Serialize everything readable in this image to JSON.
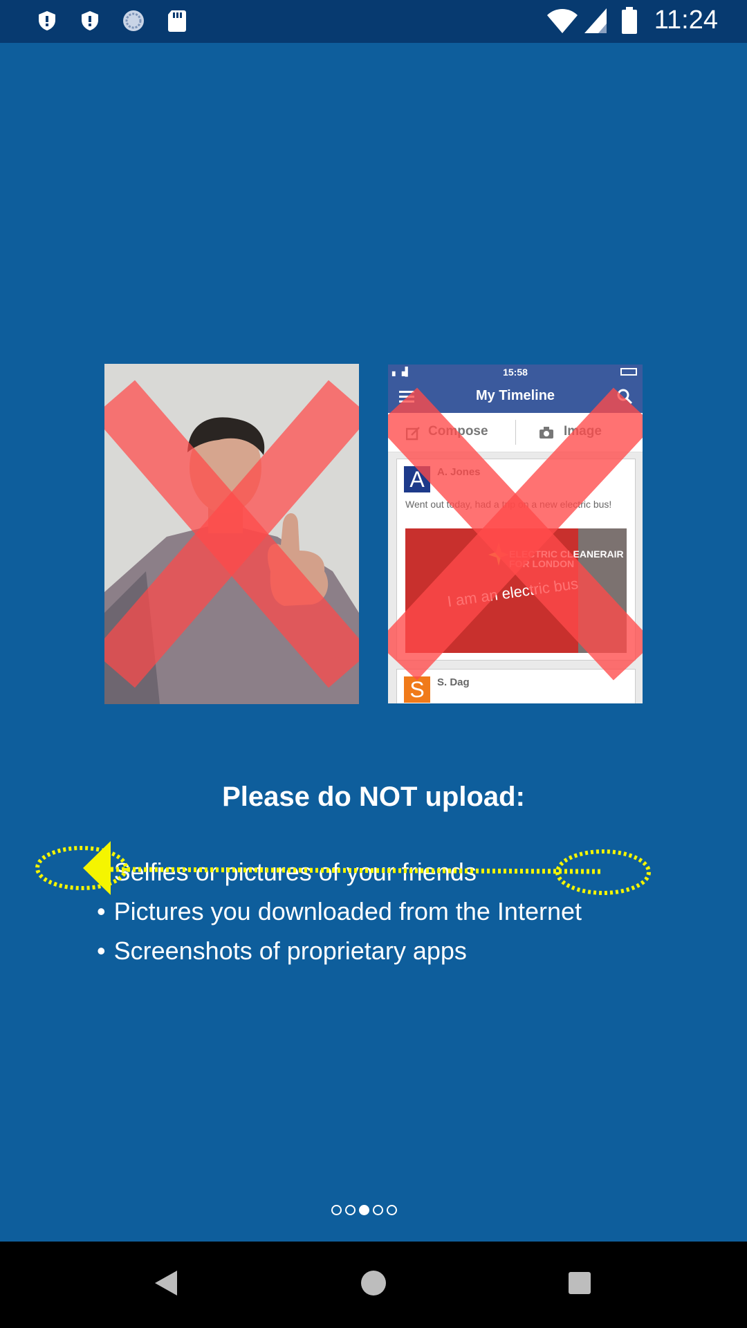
{
  "status_bar": {
    "time": "11:24",
    "icons": [
      "shield-icon",
      "shield-icon",
      "sync-icon",
      "sd-card-icon",
      "wifi-icon",
      "signal-icon",
      "battery-icon"
    ]
  },
  "phone_mockup": {
    "status_time": "15:58",
    "app_title": "My Timeline",
    "actions": [
      "Compose",
      "Image"
    ],
    "posts": [
      {
        "avatar_letter": "A",
        "name": "A. Jones",
        "text": "Went out today, had a trip on a new electric bus!",
        "image_caption": "I am an electric bus",
        "image_brand": "ELECTRIC CLEANERAIR FOR LONDON"
      },
      {
        "avatar_letter": "S",
        "name": "S. Dag"
      }
    ]
  },
  "heading": "Please do NOT upload:",
  "items": [
    "Selfies or pictures of your friends",
    "Pictures you downloaded from the Internet",
    "Screenshots of proprietary apps"
  ],
  "pager": {
    "count": 5,
    "active_index": 2
  },
  "colors": {
    "background": "#0e5e9c",
    "status_bar": "#073a70",
    "cross": "#ff4a4a",
    "annotation": "#f5f500"
  }
}
